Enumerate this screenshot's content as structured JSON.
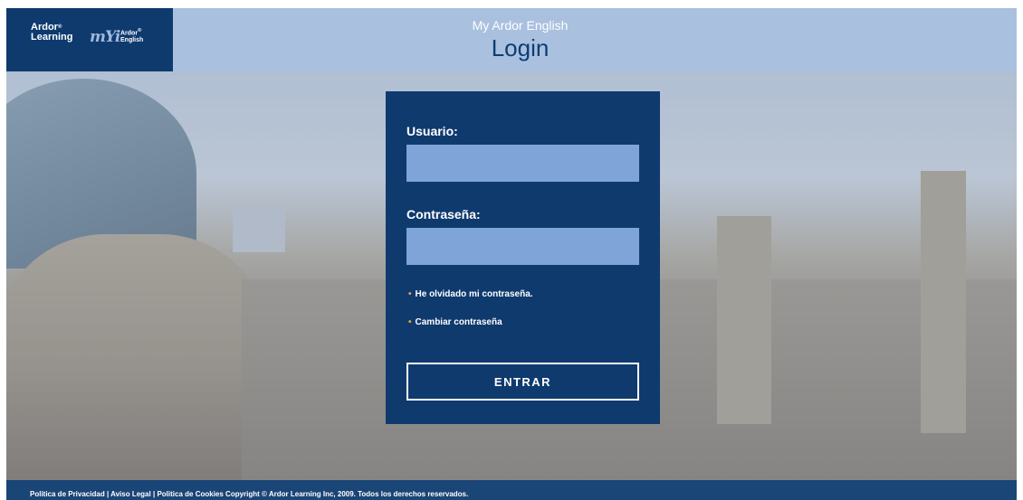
{
  "header": {
    "logo_left": {
      "line1": "Ardor",
      "line2": "Learning"
    },
    "logo_right": {
      "mark": "mYi",
      "line1": "Ardor",
      "line2": "English"
    },
    "app_title": "My Ardor English",
    "page_title": "Login"
  },
  "form": {
    "username_label": "Usuario:",
    "password_label": "Contraseña:",
    "username_value": "",
    "password_value": "",
    "forgot_link": "He olvidado mi contraseña.",
    "change_link": "Cambiar contraseña",
    "submit_label": "ENTRAR"
  },
  "footer": {
    "privacy": "Politica de Privacidad",
    "legal": "Aviso Legal",
    "cookies": "Politica de Cookies",
    "copyright": "Copyright © Ardor Learning Inc, 2009. Todos los derechos reservados.",
    "separator": "|"
  },
  "colors": {
    "header_bg": "#a9c0df",
    "logo_bg": "#0e3a6e",
    "panel_bg": "#0f3a6e",
    "field_bg": "#7fa4d8",
    "bullet": "#f0a830",
    "footer_bg": "#1a4577",
    "title_color": "#0f3d73"
  },
  "icons": {
    "bullet": "bullet-dot-icon"
  }
}
